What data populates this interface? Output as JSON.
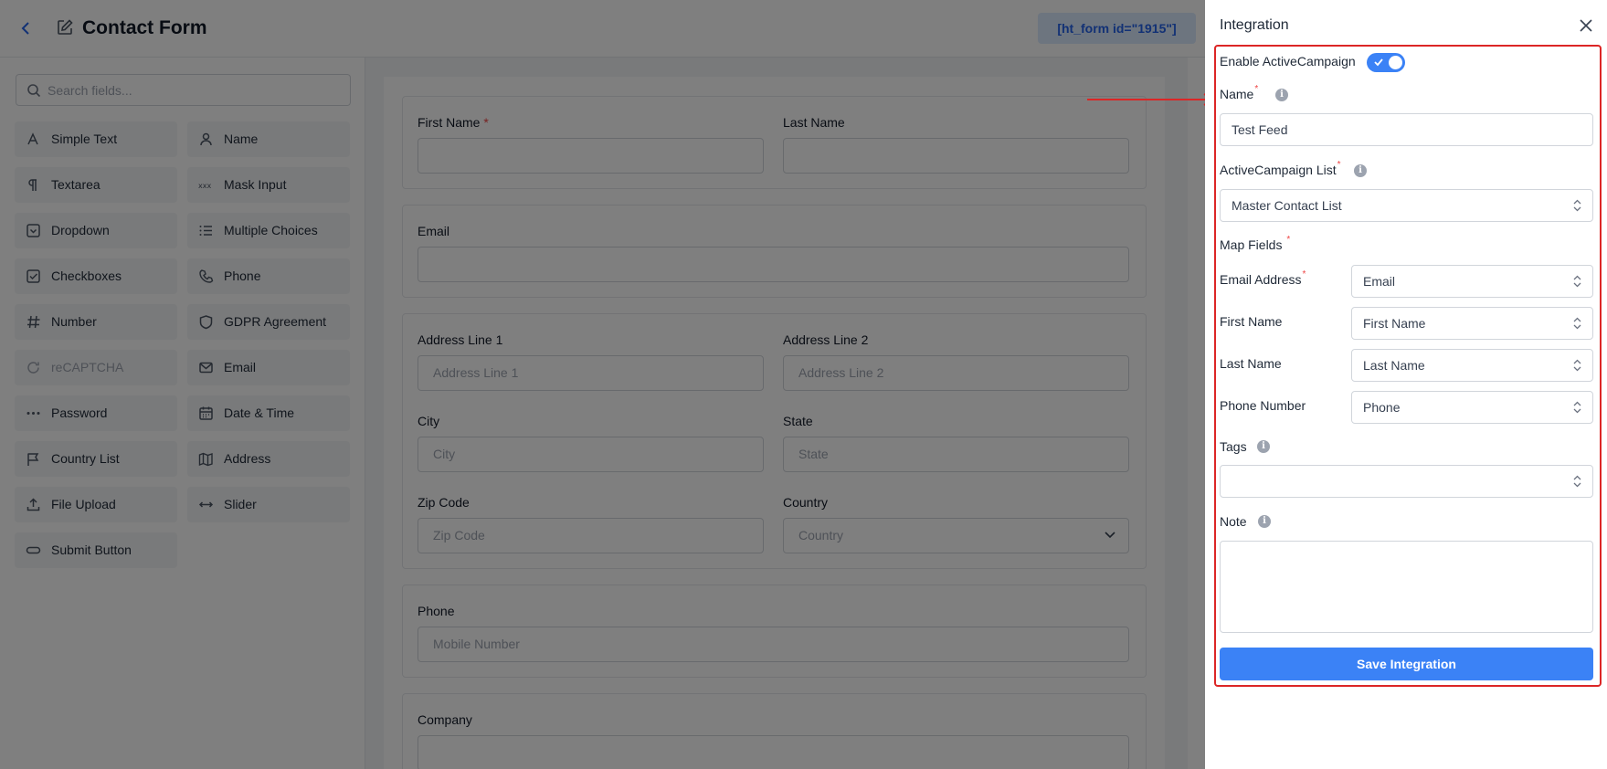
{
  "header": {
    "back_icon": "chevron-left-icon",
    "title": "Contact Form",
    "shortcode": "[ht_form id=\"1915\"]"
  },
  "sidebar": {
    "search_placeholder": "Search fields...",
    "fields": [
      {
        "label": "Simple Text",
        "icon": "text-icon"
      },
      {
        "label": "Name",
        "icon": "user-icon"
      },
      {
        "label": "Textarea",
        "icon": "paragraph-icon"
      },
      {
        "label": "Mask Input",
        "icon": "mask-icon"
      },
      {
        "label": "Dropdown",
        "icon": "dropdown-icon"
      },
      {
        "label": "Multiple Choices",
        "icon": "list-icon"
      },
      {
        "label": "Checkboxes",
        "icon": "checkbox-icon"
      },
      {
        "label": "Phone",
        "icon": "phone-icon"
      },
      {
        "label": "Number",
        "icon": "hash-icon"
      },
      {
        "label": "GDPR Agreement",
        "icon": "shield-icon"
      },
      {
        "label": "reCAPTCHA",
        "icon": "recaptcha-icon"
      },
      {
        "label": "Email",
        "icon": "mail-icon"
      },
      {
        "label": "Password",
        "icon": "password-icon"
      },
      {
        "label": "Date & Time",
        "icon": "calendar-icon"
      },
      {
        "label": "Country List",
        "icon": "flag-icon"
      },
      {
        "label": "Address",
        "icon": "map-icon"
      },
      {
        "label": "File Upload",
        "icon": "upload-icon"
      },
      {
        "label": "Slider",
        "icon": "slider-icon"
      },
      {
        "label": "Submit Button",
        "icon": "button-icon"
      }
    ]
  },
  "form": {
    "first_name": "First Name",
    "last_name": "Last Name",
    "email": "Email",
    "address_line1": "Address Line 1",
    "address_line1_placeholder": "Address Line 1",
    "address_line2": "Address Line 2",
    "address_line2_placeholder": "Address Line 2",
    "city": "City",
    "city_placeholder": "City",
    "state": "State",
    "state_placeholder": "State",
    "zip": "Zip Code",
    "zip_placeholder": "Zip Code",
    "country": "Country",
    "country_placeholder": "Country",
    "phone": "Phone",
    "phone_placeholder": "Mobile Number",
    "company": "Company"
  },
  "drawer": {
    "title": "Integration",
    "enable_label": "Enable ActiveCampaign",
    "enabled": true,
    "name_label": "Name",
    "name_value": "Test Feed",
    "list_label": "ActiveCampaign List",
    "list_value": "Master Contact List",
    "map_fields_label": "Map Fields",
    "mappings": [
      {
        "label": "Email Address",
        "required": true,
        "value": "Email"
      },
      {
        "label": "First Name",
        "required": false,
        "value": "First Name"
      },
      {
        "label": "Last Name",
        "required": false,
        "value": "Last Name"
      },
      {
        "label": "Phone Number",
        "required": false,
        "value": "Phone"
      }
    ],
    "tags_label": "Tags",
    "tags_value": "",
    "note_label": "Note",
    "save_label": "Save Integration",
    "required_mark": "*",
    "info_mark": "i"
  },
  "colors": {
    "accent": "#3b82f6",
    "highlight": "#dc2626",
    "required": "#ef4444"
  }
}
